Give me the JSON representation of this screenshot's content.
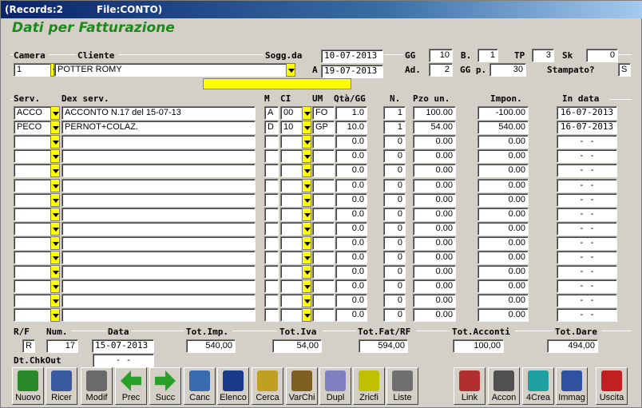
{
  "window": {
    "records": "(Records:2",
    "file": "File:CONTO)"
  },
  "form": {
    "title": "Dati per Fatturazione"
  },
  "header": {
    "camera_label": "Camera",
    "cliente_label": "Cliente",
    "sogg_label": "Sogg.da",
    "a_label": "A",
    "gg_label": "GG",
    "b_label": "B.",
    "tp_label": "TP",
    "sk_label": "Sk",
    "ad_label": "Ad.",
    "ggp_label": "GG p.",
    "stampato_label": "Stampato?",
    "camera": "1",
    "cliente": "POTTER ROMY",
    "sogg_da": "10-07-2013",
    "sogg_a": "19-07-2013",
    "gg": "10",
    "b": "1",
    "tp": "3",
    "sk": "0",
    "ad": "2",
    "ggp": "30",
    "stampato": "S"
  },
  "columns": {
    "serv": "Serv.",
    "dex": "Dex serv.",
    "m": "M",
    "ci": "CI",
    "um": "UM",
    "qta": "Qtà/GG",
    "n": "N.",
    "pzo": "Pzo un.",
    "impon": "Impon.",
    "indata": "In data"
  },
  "rows": [
    {
      "serv": "ACCO",
      "dex": "ACCONTO      N.17 del 15-07-13",
      "m": "A",
      "ci": "00",
      "um": "FO",
      "qta": "1.0",
      "n": "1",
      "pzo": "100.00",
      "impon": "-100.00",
      "indata": "16-07-2013"
    },
    {
      "serv": "PECO",
      "dex": "PERNOT+COLAZ.",
      "m": "D",
      "ci": "10",
      "um": "GP",
      "qta": "10.0",
      "n": "1",
      "pzo": "54.00",
      "impon": "540.00",
      "indata": "16-07-2013"
    },
    {
      "serv": "",
      "dex": "",
      "m": "",
      "ci": "",
      "um": "",
      "qta": "0.0",
      "n": "0",
      "pzo": "0.00",
      "impon": "0.00",
      "indata": "-  -"
    },
    {
      "serv": "",
      "dex": "",
      "m": "",
      "ci": "",
      "um": "",
      "qta": "0.0",
      "n": "0",
      "pzo": "0.00",
      "impon": "0.00",
      "indata": "-  -"
    },
    {
      "serv": "",
      "dex": "",
      "m": "",
      "ci": "",
      "um": "",
      "qta": "0.0",
      "n": "0",
      "pzo": "0.00",
      "impon": "0.00",
      "indata": "-  -"
    },
    {
      "serv": "",
      "dex": "",
      "m": "",
      "ci": "",
      "um": "",
      "qta": "0.0",
      "n": "0",
      "pzo": "0.00",
      "impon": "0.00",
      "indata": "-  -"
    },
    {
      "serv": "",
      "dex": "",
      "m": "",
      "ci": "",
      "um": "",
      "qta": "0.0",
      "n": "0",
      "pzo": "0.00",
      "impon": "0.00",
      "indata": "-  -"
    },
    {
      "serv": "",
      "dex": "",
      "m": "",
      "ci": "",
      "um": "",
      "qta": "0.0",
      "n": "0",
      "pzo": "0.00",
      "impon": "0.00",
      "indata": "-  -"
    },
    {
      "serv": "",
      "dex": "",
      "m": "",
      "ci": "",
      "um": "",
      "qta": "0.0",
      "n": "0",
      "pzo": "0.00",
      "impon": "0.00",
      "indata": "-  -"
    },
    {
      "serv": "",
      "dex": "",
      "m": "",
      "ci": "",
      "um": "",
      "qta": "0.0",
      "n": "0",
      "pzo": "0.00",
      "impon": "0.00",
      "indata": "-  -"
    },
    {
      "serv": "",
      "dex": "",
      "m": "",
      "ci": "",
      "um": "",
      "qta": "0.0",
      "n": "0",
      "pzo": "0.00",
      "impon": "0.00",
      "indata": "-  -"
    },
    {
      "serv": "",
      "dex": "",
      "m": "",
      "ci": "",
      "um": "",
      "qta": "0.0",
      "n": "0",
      "pzo": "0.00",
      "impon": "0.00",
      "indata": "-  -"
    },
    {
      "serv": "",
      "dex": "",
      "m": "",
      "ci": "",
      "um": "",
      "qta": "0.0",
      "n": "0",
      "pzo": "0.00",
      "impon": "0.00",
      "indata": "-  -"
    },
    {
      "serv": "",
      "dex": "",
      "m": "",
      "ci": "",
      "um": "",
      "qta": "0.0",
      "n": "0",
      "pzo": "0.00",
      "impon": "0.00",
      "indata": "-  -"
    },
    {
      "serv": "",
      "dex": "",
      "m": "",
      "ci": "",
      "um": "",
      "qta": "0.0",
      "n": "0",
      "pzo": "0.00",
      "impon": "0.00",
      "indata": "-  -"
    }
  ],
  "footer": {
    "rf_label": "R/F",
    "num_label": "Num.",
    "data_label": "Data",
    "totimp_label": "Tot.Imp.",
    "totiva_label": "Tot.Iva",
    "totfat_label": "Tot.Fat/RF",
    "totacc_label": "Tot.Acconti",
    "totdare_label": "Tot.Dare",
    "chkout_label": "Dt.ChkOut",
    "rf": "R",
    "num": "17",
    "data": "15-07-2013",
    "totimp": "540,00",
    "totiva": "54,00",
    "totfat": "594,00",
    "totacc": "100,00",
    "totdare": "494,00",
    "chkout": "-  -"
  },
  "toolbar": [
    {
      "label": "Nuovo",
      "icon": "new-doc-icon"
    },
    {
      "label": "Ricer",
      "icon": "search-icon"
    },
    {
      "label": "Modif",
      "icon": "edit-icon"
    },
    {
      "label": "Prec",
      "icon": "arrow-left-icon"
    },
    {
      "label": "Succ",
      "icon": "arrow-right-icon"
    },
    {
      "label": "Canc",
      "icon": "trash-icon"
    },
    {
      "label": "Elenco",
      "icon": "list-icon"
    },
    {
      "label": "Cerca",
      "icon": "find-icon"
    },
    {
      "label": "VarChi",
      "icon": "keys-icon"
    },
    {
      "label": "Dupl",
      "icon": "duplicate-icon"
    },
    {
      "label": "Zricfi",
      "icon": "zricfi-icon"
    },
    {
      "label": "Liste",
      "icon": "printer-list-icon"
    },
    {
      "label": "Link",
      "icon": "link-icon"
    },
    {
      "label": "Accon",
      "icon": "printer-icon"
    },
    {
      "label": "4Crea",
      "icon": "create-icon"
    },
    {
      "label": "Immag",
      "icon": "image-icon"
    },
    {
      "label": "Uscita",
      "icon": "exit-icon"
    }
  ]
}
